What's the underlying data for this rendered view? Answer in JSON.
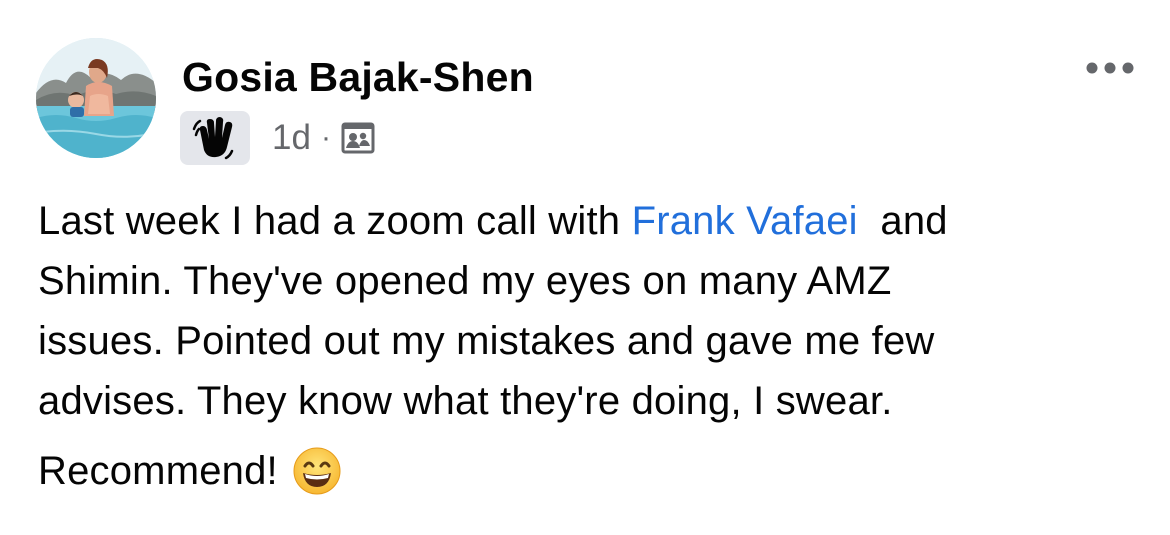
{
  "post": {
    "author_name": "Gosia Bajak-Shen",
    "time": "1d",
    "separator": "·",
    "badge_icon": "waving-hand-icon",
    "audience_icon": "friends-audience-icon",
    "more_icon": "more-options-icon",
    "body": {
      "line1_before": "Last week I had a zoom call with ",
      "mention": "Frank Vafaei",
      "line1_after": "  and",
      "line2": "Shimin. They've opened my eyes on many AMZ",
      "line3": "issues. Pointed out my mistakes and gave me few",
      "line4": "advises. They know what they're doing, I swear.",
      "closing": "Recommend!",
      "closing_emoji": "grinning-face-emoji"
    }
  },
  "colors": {
    "mention": "#216fdb",
    "secondary_text": "#65676b",
    "badge_bg": "#e4e6eb"
  }
}
